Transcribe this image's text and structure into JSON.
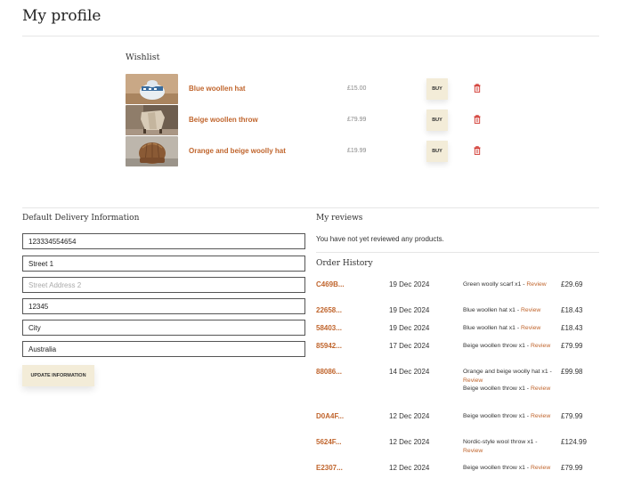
{
  "page": {
    "title": "My profile"
  },
  "wishlist": {
    "heading": "Wishlist",
    "buy_label": "BUY",
    "items": [
      {
        "name": "Blue woollen hat",
        "price": "£15.00"
      },
      {
        "name": "Beige woollen throw",
        "price": "£79.99"
      },
      {
        "name": "Orange and beige woolly hat",
        "price": "£19.99"
      }
    ]
  },
  "delivery": {
    "heading": "Default Delivery Information",
    "fields": [
      {
        "value": "123334554654",
        "placeholder": ""
      },
      {
        "value": "Street 1",
        "placeholder": ""
      },
      {
        "value": "",
        "placeholder": "Street Address 2"
      },
      {
        "value": "12345",
        "placeholder": ""
      },
      {
        "value": "City",
        "placeholder": ""
      },
      {
        "value": "Australia",
        "placeholder": ""
      }
    ],
    "update_label": "UPDATE INFORMATION"
  },
  "reviews": {
    "heading": "My reviews",
    "empty_text": "You have not yet reviewed any products."
  },
  "orders": {
    "heading": "Order History",
    "rows": [
      {
        "id": "C469B...",
        "date": "19 Dec 2024",
        "items": [
          {
            "text": "Green woolly scarf x1 - ",
            "review": "Review"
          }
        ],
        "total": "£29.69"
      },
      {
        "id": "22658...",
        "date": "19 Dec 2024",
        "items": [
          {
            "text": "Blue woollen hat x1 - ",
            "review": "Review"
          }
        ],
        "total": "£18.43"
      },
      {
        "id": "58403...",
        "date": "19 Dec 2024",
        "items": [
          {
            "text": "Blue woollen hat x1 - ",
            "review": "Review"
          }
        ],
        "total": "£18.43"
      },
      {
        "id": "85942...",
        "date": "17 Dec 2024",
        "items": [
          {
            "text": "Beige woollen throw x1 - ",
            "review": "Review"
          }
        ],
        "total": "£79.99"
      },
      {
        "id": "88086...",
        "date": "14 Dec 2024",
        "items": [
          {
            "text": "Orange and beige woolly hat x1 - ",
            "review": "Review"
          },
          {
            "text": "Beige woollen throw x1 - ",
            "review": "Review"
          }
        ],
        "total": "£99.98"
      },
      {
        "id": "D0A4F...",
        "date": "12 Dec 2024",
        "items": [
          {
            "text": "Beige woollen throw x1 - ",
            "review": "Review"
          }
        ],
        "total": "£79.99"
      },
      {
        "id": "5624F...",
        "date": "12 Dec 2024",
        "items": [
          {
            "text": "Nordic-style wool throw x1 - ",
            "review": "Review"
          }
        ],
        "total": "£124.99"
      },
      {
        "id": "E2307...",
        "date": "12 Dec 2024",
        "items": [
          {
            "text": "Beige woollen throw x1 - ",
            "review": "Review"
          }
        ],
        "total": "£79.99"
      }
    ]
  },
  "colors": {
    "accent": "#c0652d",
    "button_bg": "#f3ecd8",
    "trash": "#d0332b"
  },
  "icons": {
    "trash": "trash-icon"
  }
}
